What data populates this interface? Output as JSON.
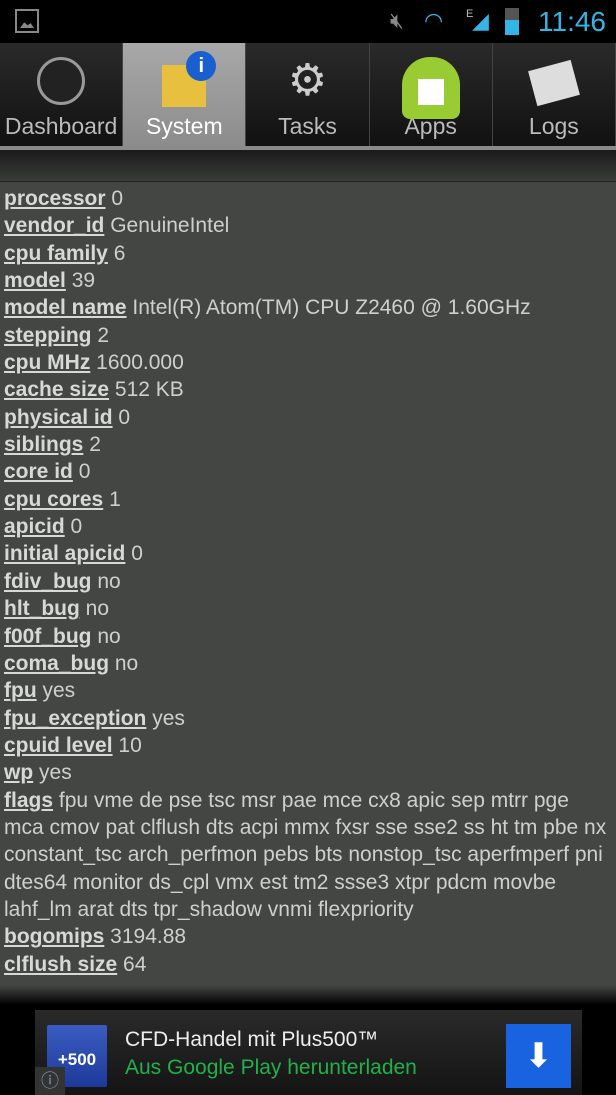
{
  "status_bar": {
    "time": "11:46",
    "icons": [
      "gallery-icon",
      "mute-icon",
      "wifi-icon",
      "signal-edge-icon",
      "battery-icon"
    ],
    "network_label": "E"
  },
  "tabs": [
    {
      "label": "Dashboard",
      "icon": "gauge-icon",
      "selected": false
    },
    {
      "label": "System",
      "icon": "system-info-icon",
      "selected": true
    },
    {
      "label": "Tasks",
      "icon": "gears-icon",
      "selected": false
    },
    {
      "label": "Apps",
      "icon": "android-icon",
      "selected": false
    },
    {
      "label": "Logs",
      "icon": "newspaper-icon",
      "selected": false
    }
  ],
  "cpu_info": [
    {
      "key": "processor",
      "value": "0"
    },
    {
      "key": "vendor_id",
      "value": "GenuineIntel"
    },
    {
      "key": "cpu family",
      "value": "6"
    },
    {
      "key": "model",
      "value": "39"
    },
    {
      "key": "model name",
      "value": "Intel(R) Atom(TM) CPU Z2460 @ 1.60GHz"
    },
    {
      "key": "stepping",
      "value": "2"
    },
    {
      "key": "cpu MHz",
      "value": "1600.000"
    },
    {
      "key": "cache size",
      "value": "512 KB"
    },
    {
      "key": "physical id",
      "value": "0"
    },
    {
      "key": "siblings",
      "value": "2"
    },
    {
      "key": "core id",
      "value": "0"
    },
    {
      "key": "cpu cores",
      "value": "1"
    },
    {
      "key": "apicid",
      "value": "0"
    },
    {
      "key": "initial apicid",
      "value": "0"
    },
    {
      "key": "fdiv_bug",
      "value": "no"
    },
    {
      "key": "hlt_bug",
      "value": "no"
    },
    {
      "key": "f00f_bug",
      "value": "no"
    },
    {
      "key": "coma_bug",
      "value": "no"
    },
    {
      "key": "fpu",
      "value": "yes"
    },
    {
      "key": "fpu_exception",
      "value": "yes"
    },
    {
      "key": "cpuid level",
      "value": "10"
    },
    {
      "key": "wp",
      "value": "yes"
    },
    {
      "key": "flags",
      "value": "fpu vme de pse tsc msr pae mce cx8 apic sep mtrr pge mca cmov pat clflush dts acpi mmx fxsr sse sse2 ss ht tm pbe nx constant_tsc arch_perfmon pebs bts nonstop_tsc aperfmperf pni dtes64 monitor ds_cpl vmx est tm2 ssse3 xtpr pdcm movbe lahf_lm arat dts tpr_shadow vnmi flexpriority"
    },
    {
      "key": "bogomips",
      "value": "3194.88"
    },
    {
      "key": "clflush size",
      "value": "64"
    }
  ],
  "ad": {
    "logo_text": "+500",
    "title": "CFD-Handel mit Plus500™",
    "subtitle": "Aus Google Play herunterladen",
    "accent": "#1a63e0",
    "subtitle_color": "#1fb24a"
  }
}
